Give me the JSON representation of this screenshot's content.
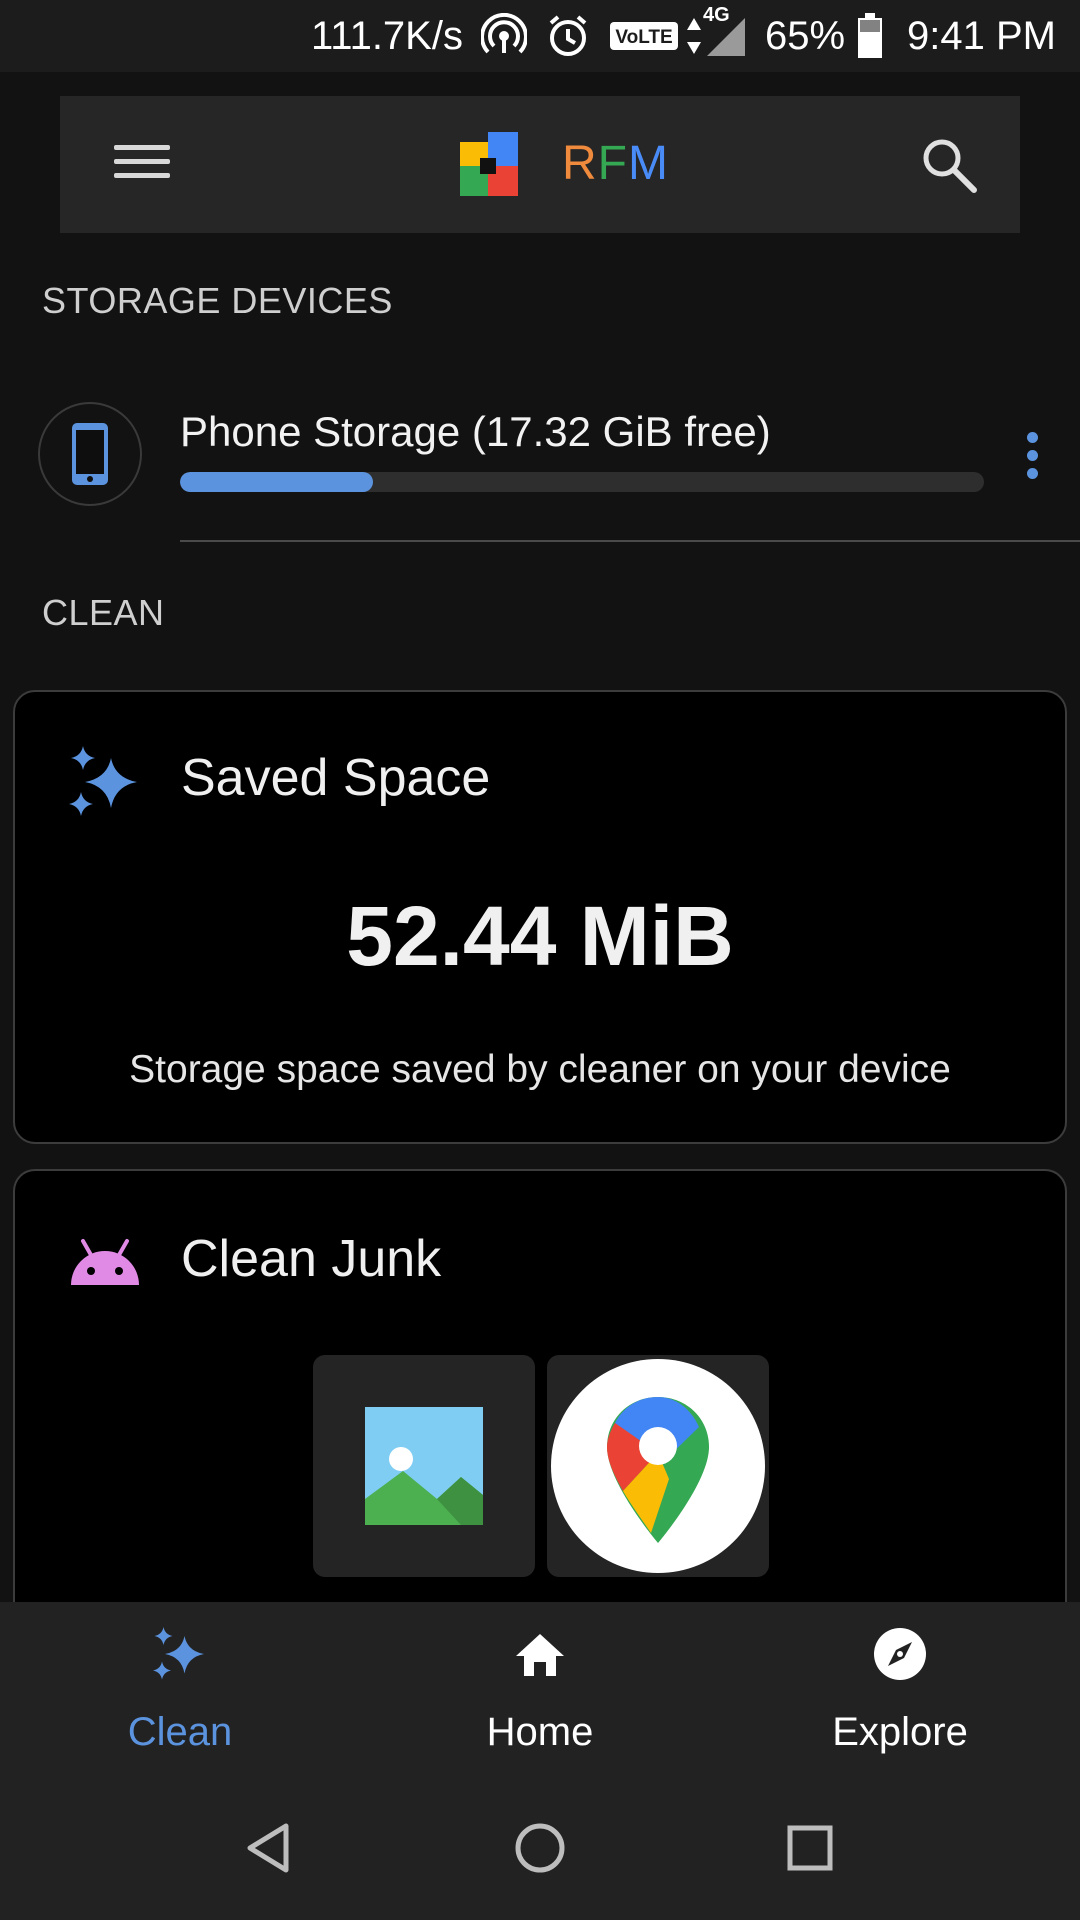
{
  "status_bar": {
    "net_speed": "111.7K/s",
    "network_type": "4G",
    "volte_label": "VoLTE",
    "battery": "65%",
    "time": "9:41 PM",
    "icons": [
      "hotspot-icon",
      "alarm-icon",
      "volte-icon",
      "data-arrows-icon",
      "signal-icon",
      "battery-icon"
    ]
  },
  "app_bar": {
    "title_r": "R",
    "title_f": "F",
    "title_m": "M",
    "menu_icon": "hamburger-menu-icon",
    "search_icon": "search-icon"
  },
  "sections": {
    "storage_devices": "STORAGE DEVICES",
    "clean": "CLEAN"
  },
  "storage": {
    "device_label": "Phone Storage (17.32 GiB free)",
    "used_fraction": 0.24,
    "accent": "#5b93de"
  },
  "saved_space": {
    "title": "Saved Space",
    "value": "52.44 MiB",
    "description": "Storage space saved by cleaner on your device"
  },
  "clean_junk": {
    "title": "Clean Junk",
    "apps": [
      "gallery-app-icon",
      "maps-app-icon"
    ]
  },
  "bottom_nav": {
    "items": [
      {
        "label": "Clean",
        "icon": "sparkle-icon",
        "active": true
      },
      {
        "label": "Home",
        "icon": "home-icon",
        "active": false
      },
      {
        "label": "Explore",
        "icon": "compass-icon",
        "active": false
      }
    ]
  },
  "system_nav": [
    "back-icon",
    "home-circle-icon",
    "recents-icon"
  ]
}
